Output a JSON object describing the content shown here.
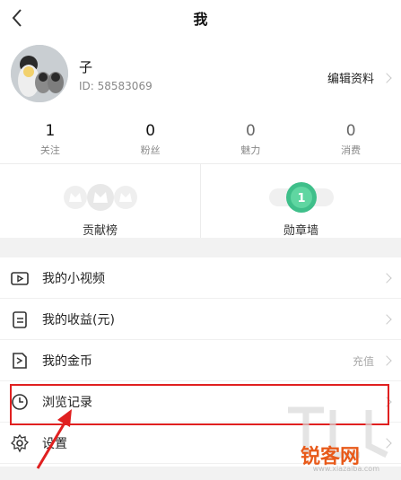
{
  "header": {
    "title": "我"
  },
  "profile": {
    "name": "子",
    "user_id": "ID: 58583069",
    "edit_label": "编辑资料"
  },
  "stats": [
    {
      "value": "1",
      "label": "关注"
    },
    {
      "value": "0",
      "label": "粉丝"
    },
    {
      "value": "0",
      "label": "魅力"
    },
    {
      "value": "0",
      "label": "消费"
    }
  ],
  "features": {
    "contribution": {
      "label": "贡献榜"
    },
    "badges": {
      "label": "勋章墙",
      "badge_count": "1"
    }
  },
  "menu": {
    "items": [
      {
        "label": "我的小视频",
        "right": ""
      },
      {
        "label": "我的收益(元)",
        "right": ""
      },
      {
        "label": "我的金币",
        "right": "充值"
      },
      {
        "label": "浏览记录",
        "right": ""
      },
      {
        "label": "设置",
        "right": ""
      }
    ]
  },
  "watermark": {
    "text": "锐客网",
    "domain": "www.xiazaiba.com"
  },
  "colors": {
    "highlight": "#e02020",
    "badge_green": "#3fbf8a",
    "watermark_orange": "#e85a1a"
  }
}
